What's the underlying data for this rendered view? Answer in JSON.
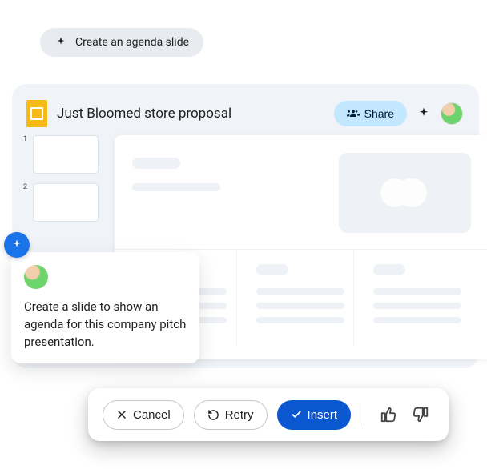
{
  "suggestion": {
    "label": "Create an agenda slide"
  },
  "header": {
    "doc_title": "Just Bloomed store proposal",
    "share_label": "Share"
  },
  "thumbnails": {
    "slides": [
      {
        "number": "1"
      },
      {
        "number": "2"
      }
    ]
  },
  "prompt": {
    "text": "Create a slide to show an agenda for this company pitch presentation."
  },
  "actions": {
    "cancel_label": "Cancel",
    "retry_label": "Retry",
    "insert_label": "Insert"
  },
  "icons": {
    "spark": "spark-icon",
    "share_people": "people-icon",
    "close": "close-icon",
    "retry": "retry-icon",
    "check": "check-icon",
    "thumbs_up": "thumbs-up-icon",
    "thumbs_down": "thumbs-down-icon"
  }
}
